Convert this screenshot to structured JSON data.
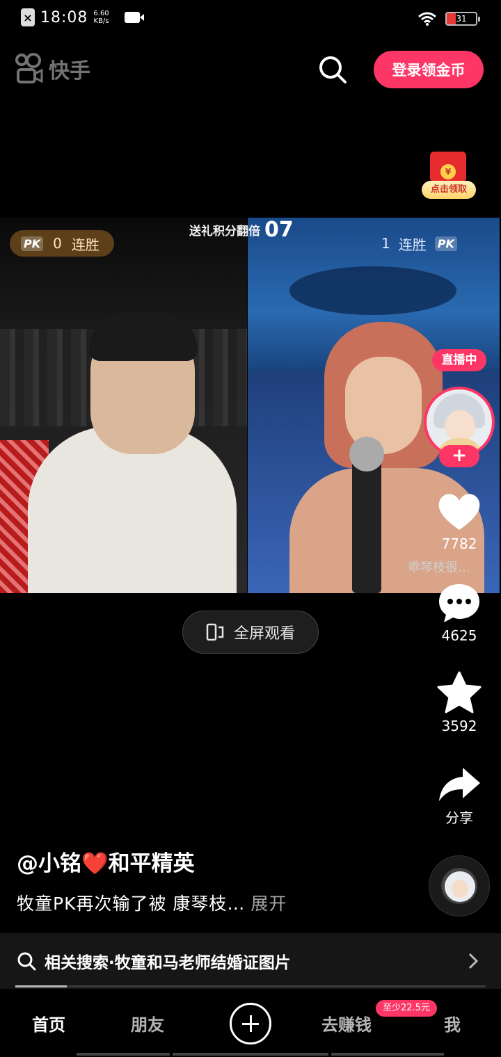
{
  "status_bar": {
    "time": "18:08",
    "speed_value": "6.60",
    "speed_unit": "KB/s",
    "battery": "31",
    "battery_level": 0.31
  },
  "header": {
    "app_name": "快手",
    "login_button": "登录领金币"
  },
  "red_packet": {
    "coin_symbol": "¥",
    "label": "点击领取"
  },
  "pk": {
    "left_streak": "0",
    "right_streak": "1",
    "streak_label": "连胜",
    "badge": "PK",
    "title": "送礼积分翻倍",
    "countdown": "07"
  },
  "side": {
    "live_label": "直播中",
    "follow": "+",
    "likes": "7782",
    "caption": "乖琴枝很…",
    "comments": "4625",
    "favorites": "3592",
    "share_label": "分享"
  },
  "fullscreen_label": "全屏观看",
  "post": {
    "author": "@小铭❤️和平精英",
    "caption": "牧童PK再次输了被 康琴枝…",
    "expand": "展开"
  },
  "related": {
    "text": "相关搜索·牧童和马老师结婚证图片"
  },
  "progress": 0.11,
  "nav": {
    "home": "首页",
    "friends": "朋友",
    "earn": "去赚钱",
    "earn_badge": "至少22.5元",
    "me": "我"
  },
  "colors": {
    "accent": "#fe3666",
    "background": "#000000"
  }
}
